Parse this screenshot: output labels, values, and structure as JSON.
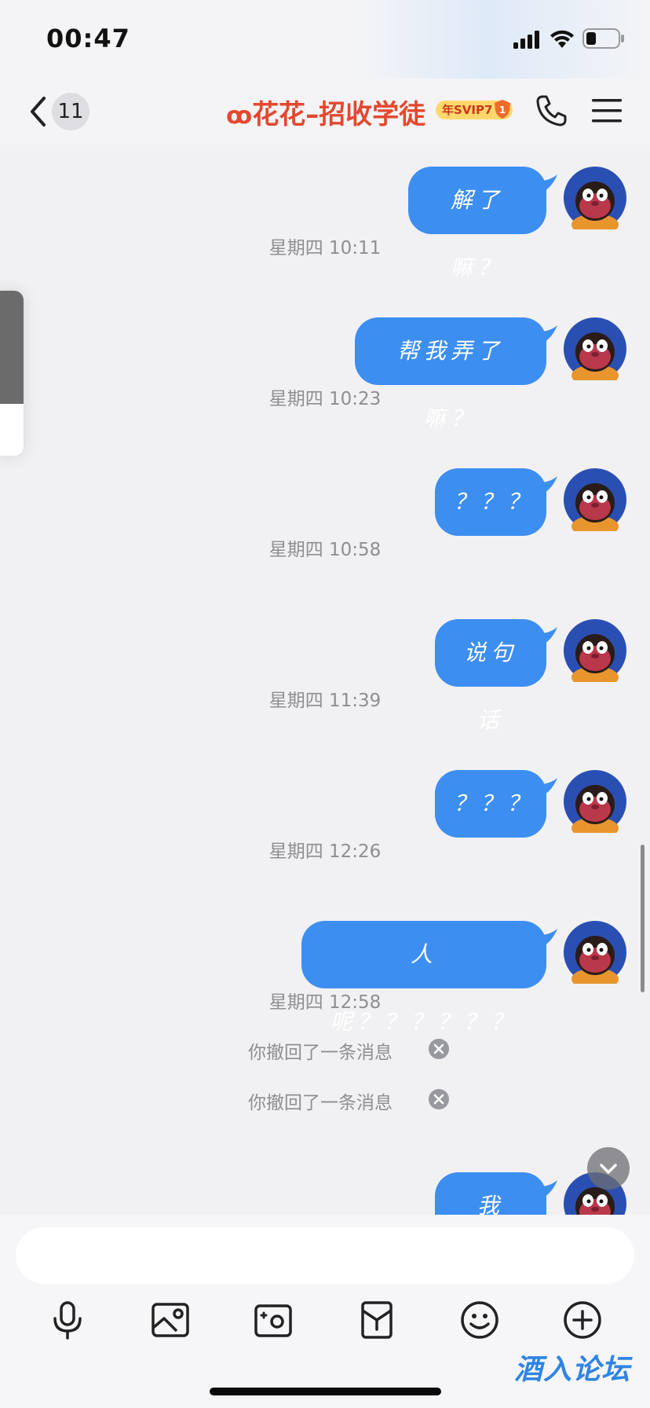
{
  "status_bar": {
    "time": "00:47"
  },
  "header": {
    "unread_count": "11",
    "title": "花花–招收学徒",
    "vip_badge": "年SVIP7",
    "vip_level": "1"
  },
  "messages": [
    {
      "text": "解了嘛？"
    },
    {
      "timestamp": "星期四 10:11",
      "text": "帮我弄了嘛？"
    },
    {
      "timestamp": "星期四 10:23",
      "text": "？？？"
    },
    {
      "timestamp": "星期四 10:58",
      "text": "说句话"
    },
    {
      "timestamp": "星期四 11:39",
      "text": "？？？"
    },
    {
      "timestamp": "星期四 12:26",
      "text": "人呢？？？？？？"
    },
    {
      "timestamp": "星期四 12:58"
    },
    {
      "recall": "你撤回了一条消息"
    },
    {
      "recall": "你撤回了一条消息"
    },
    {
      "text": "我日？"
    }
  ],
  "input": {
    "placeholder": ""
  },
  "toolbar": [
    "mic-icon",
    "image-icon",
    "camera-icon",
    "red-packet-icon",
    "emoji-icon",
    "plus-icon"
  ],
  "watermark": "酒入论坛",
  "colors": {
    "bubble": "#3d8ef1",
    "title": "#e4482f",
    "accent": "#2f84e4"
  }
}
